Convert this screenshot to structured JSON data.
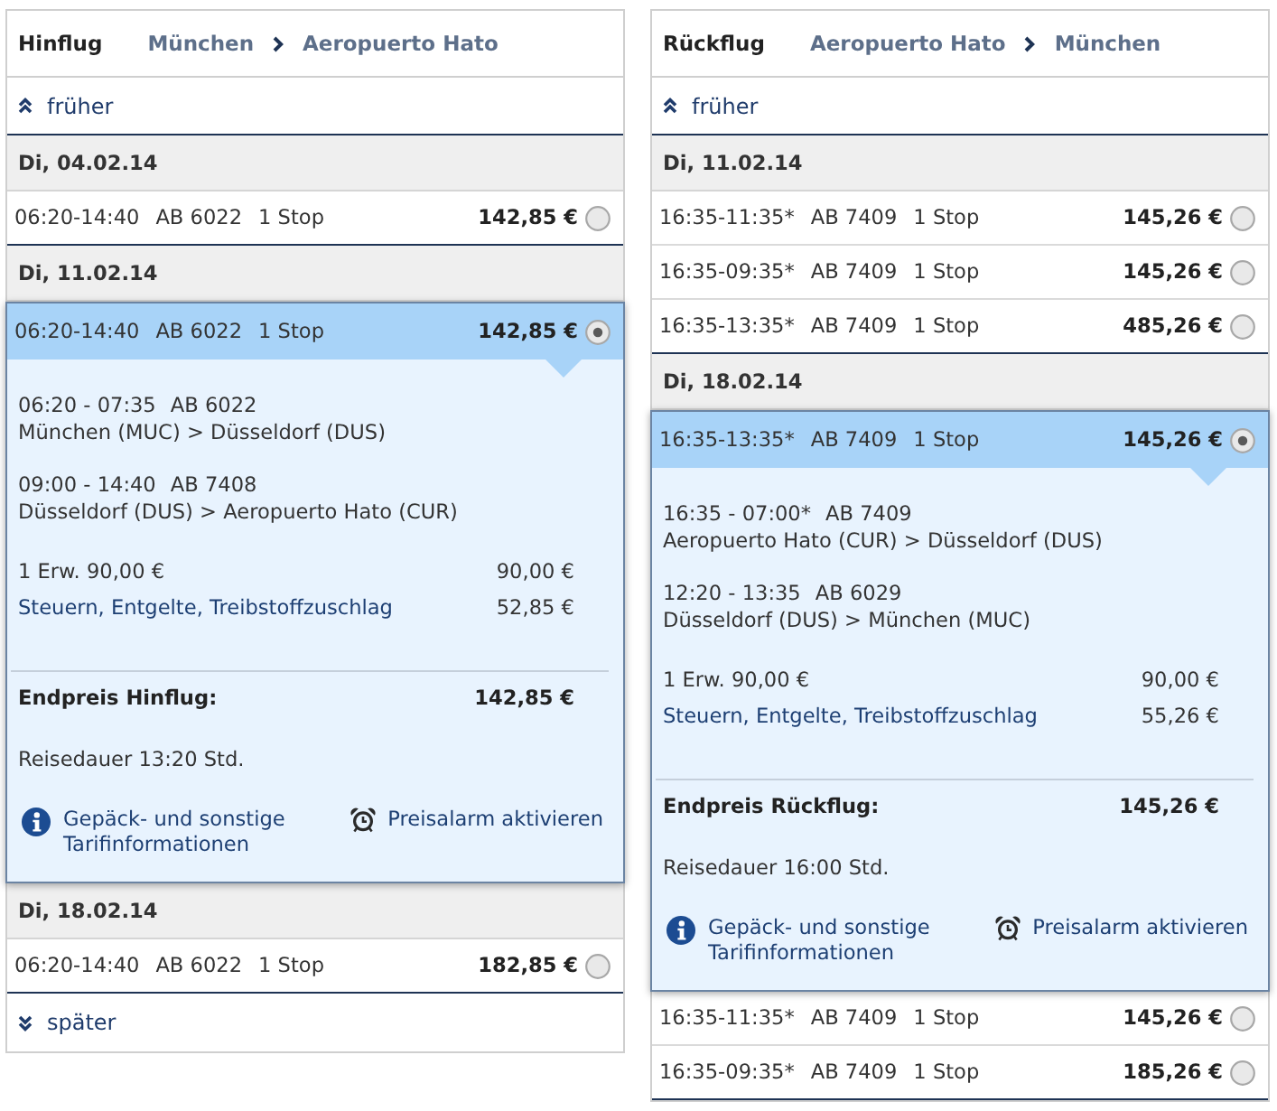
{
  "panels": [
    {
      "title": "Hinflug",
      "from": "München",
      "to": "Aeropuerto Hato",
      "earlier": "früher",
      "days": [
        {
          "date": "Di, 04.02.14",
          "flights": [
            {
              "times": "06:20-14:40",
              "flight": "AB 6022",
              "stops": "1 Stop",
              "price": "142,85 €",
              "selected": false
            }
          ]
        },
        {
          "date": "Di, 11.02.14",
          "flights": [
            {
              "times": "06:20-14:40",
              "flight": "AB 6022",
              "stops": "1 Stop",
              "price": "142,85 €",
              "selected": true,
              "details": {
                "segments": [
                  {
                    "times": "06:20 - 07:35",
                    "flight": "AB 6022",
                    "route": "München (MUC) > Düsseldorf (DUS)"
                  },
                  {
                    "times": "09:00 - 14:40",
                    "flight": "AB 7408",
                    "route": "Düsseldorf (DUS) > Aeropuerto Hato (CUR)"
                  }
                ],
                "fares": [
                  {
                    "kind": "plain",
                    "label": "1 Erw. 90,00 €",
                    "amount": "90,00 €"
                  },
                  {
                    "kind": "link",
                    "label": "Steuern, Entgelte, Treibstoffzuschlag",
                    "amount": "52,85 €"
                  }
                ],
                "total_label": "Endpreis Hinflug:",
                "total": "142,85 €",
                "duration": "Reisedauer 13:20 Std.",
                "links": [
                  {
                    "kind": "info",
                    "label": "Gepäck- und sonstige Tarifinformationen"
                  },
                  {
                    "kind": "alarm",
                    "label": "Preisalarm aktivieren"
                  }
                ]
              }
            }
          ]
        },
        {
          "date": "Di, 18.02.14",
          "flights": [
            {
              "times": "06:20-14:40",
              "flight": "AB 6022",
              "stops": "1 Stop",
              "price": "182,85 €",
              "selected": false
            }
          ]
        }
      ],
      "later": "später"
    },
    {
      "title": "Rückflug",
      "from": "Aeropuerto Hato",
      "to": "München",
      "earlier": "früher",
      "days": [
        {
          "date": "Di, 11.02.14",
          "flights": [
            {
              "times": "16:35-11:35*",
              "flight": "AB 7409",
              "stops": "1 Stop",
              "price": "145,26 €",
              "selected": false
            },
            {
              "times": "16:35-09:35*",
              "flight": "AB 7409",
              "stops": "1 Stop",
              "price": "145,26 €",
              "selected": false
            },
            {
              "times": "16:35-13:35*",
              "flight": "AB 7409",
              "stops": "1 Stop",
              "price": "485,26 €",
              "selected": false
            }
          ]
        },
        {
          "date": "Di, 18.02.14",
          "flights": [
            {
              "times": "16:35-13:35*",
              "flight": "AB 7409",
              "stops": "1 Stop",
              "price": "145,26 €",
              "selected": true,
              "details": {
                "segments": [
                  {
                    "times": "16:35 - 07:00*",
                    "flight": "AB 7409",
                    "route": "Aeropuerto Hato (CUR) > Düsseldorf (DUS)"
                  },
                  {
                    "times": "12:20 - 13:35",
                    "flight": "AB 6029",
                    "route": "Düsseldorf (DUS) > München (MUC)"
                  }
                ],
                "fares": [
                  {
                    "kind": "plain",
                    "label": "1 Erw. 90,00 €",
                    "amount": "90,00 €"
                  },
                  {
                    "kind": "link",
                    "label": "Steuern, Entgelte, Treibstoffzuschlag",
                    "amount": "55,26 €"
                  }
                ],
                "total_label": "Endpreis Rückflug:",
                "total": "145,26 €",
                "duration": "Reisedauer 16:00 Std.",
                "links": [
                  {
                    "kind": "info",
                    "label": "Gepäck- und sonstige Tarifinformationen"
                  },
                  {
                    "kind": "alarm",
                    "label": "Preisalarm aktivieren"
                  }
                ]
              }
            },
            {
              "times": "16:35-11:35*",
              "flight": "AB 7409",
              "stops": "1 Stop",
              "price": "145,26 €",
              "selected": false
            },
            {
              "times": "16:35-09:35*",
              "flight": "AB 7409",
              "stops": "1 Stop",
              "price": "185,26 €",
              "selected": false
            }
          ]
        }
      ]
    }
  ]
}
